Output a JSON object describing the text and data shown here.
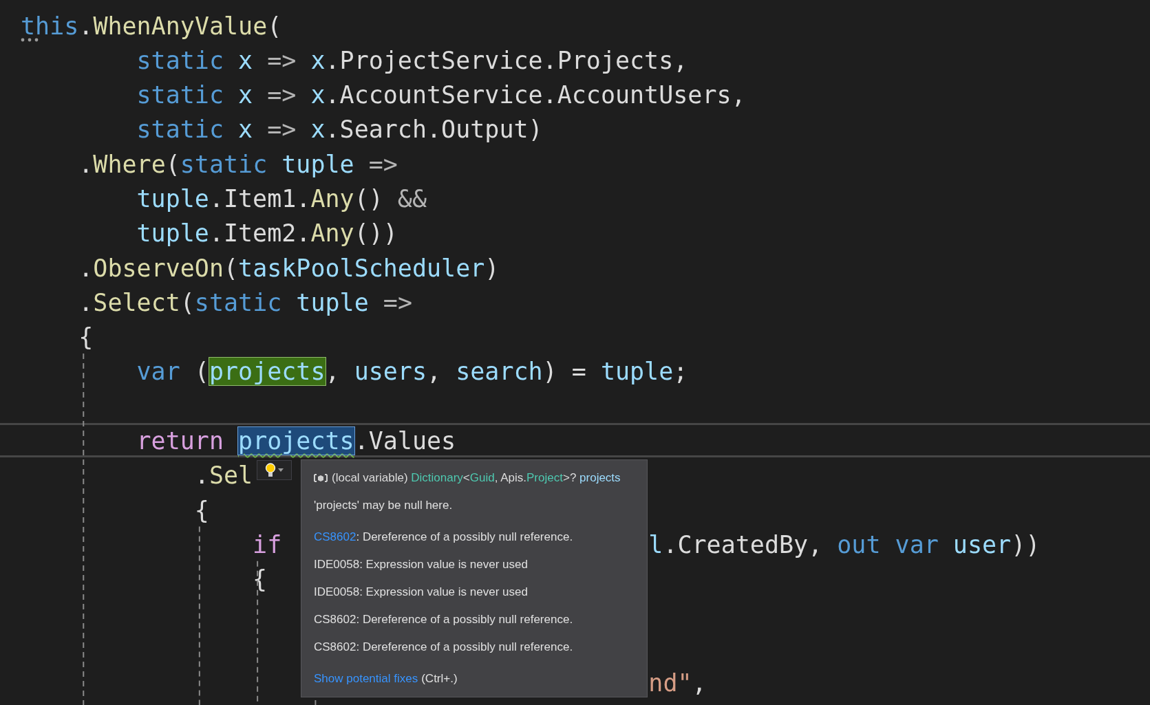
{
  "editor": {
    "lines": [
      {
        "segments": [
          {
            "tokens": [
              {
                "text": "this",
                "kind": "keyword"
              },
              {
                "text": ".",
                "kind": "plain"
              },
              {
                "text": "WhenAnyValue",
                "kind": "method"
              },
              {
                "text": "(",
                "kind": "plain"
              }
            ]
          }
        ],
        "suggestion_dots": true,
        "children": [
          {
            "kind": "argument",
            "segments": [
              {
                "tokens": [
                  {
                    "text": "static",
                    "kind": "keyword"
                  },
                  {
                    "text": " x",
                    "kind": "variable"
                  },
                  {
                    "text": " => ",
                    "kind": "operator"
                  },
                  {
                    "text": "x",
                    "kind": "variable"
                  },
                  {
                    "text": ".ProjectService.Projects,",
                    "kind": "plain"
                  }
                ]
              }
            ]
          },
          {
            "kind": "argument",
            "segments": [
              {
                "tokens": [
                  {
                    "text": "static",
                    "kind": "keyword"
                  },
                  {
                    "text": " x",
                    "kind": "variable"
                  },
                  {
                    "text": " => ",
                    "kind": "operator"
                  },
                  {
                    "text": "x",
                    "kind": "variable"
                  },
                  {
                    "text": ".AccountService.AccountUsers,",
                    "kind": "plain"
                  }
                ]
              }
            ]
          },
          {
            "kind": "argument",
            "segments": [
              {
                "tokens": [
                  {
                    "text": "static",
                    "kind": "keyword"
                  },
                  {
                    "text": " x",
                    "kind": "variable"
                  },
                  {
                    "text": " => ",
                    "kind": "operator"
                  },
                  {
                    "text": "x",
                    "kind": "variable"
                  },
                  {
                    "text": ".Search.Output)",
                    "kind": "plain"
                  }
                ]
              }
            ]
          },
          {
            "segments": [
              {
                "tokens": [
                  {
                    "text": ".",
                    "kind": "plain"
                  },
                  {
                    "text": "Where",
                    "kind": "method"
                  },
                  {
                    "text": "(",
                    "kind": "plain"
                  },
                  {
                    "text": "static",
                    "kind": "keyword"
                  },
                  {
                    "text": " tuple",
                    "kind": "variable"
                  },
                  {
                    "text": " =>",
                    "kind": "operator"
                  }
                ]
              }
            ],
            "children": [
              {
                "segments": [
                  {
                    "tokens": [
                      {
                        "text": "tuple",
                        "kind": "variable"
                      },
                      {
                        "text": ".Item1.",
                        "kind": "plain"
                      },
                      {
                        "text": "Any",
                        "kind": "method"
                      },
                      {
                        "text": "() ",
                        "kind": "plain"
                      },
                      {
                        "text": "&&",
                        "kind": "operator"
                      }
                    ]
                  }
                ]
              },
              {
                "segments": [
                  {
                    "tokens": [
                      {
                        "text": "tuple",
                        "kind": "variable"
                      },
                      {
                        "text": ".Item2.",
                        "kind": "plain"
                      },
                      {
                        "text": "Any",
                        "kind": "method"
                      },
                      {
                        "text": "())",
                        "kind": "plain"
                      }
                    ]
                  }
                ]
              }
            ]
          },
          {
            "segments": [
              {
                "tokens": [
                  {
                    "text": ".",
                    "kind": "plain"
                  },
                  {
                    "text": "ObserveOn",
                    "kind": "method"
                  },
                  {
                    "text": "(",
                    "kind": "plain"
                  },
                  {
                    "text": "taskPoolScheduler",
                    "kind": "variable"
                  },
                  {
                    "text": ")",
                    "kind": "plain"
                  }
                ]
              }
            ]
          },
          {
            "segments": [
              {
                "tokens": [
                  {
                    "text": ".",
                    "kind": "plain"
                  },
                  {
                    "text": "Select",
                    "kind": "method"
                  },
                  {
                    "text": "(",
                    "kind": "plain"
                  },
                  {
                    "text": "static",
                    "kind": "keyword"
                  },
                  {
                    "text": " tuple",
                    "kind": "variable"
                  },
                  {
                    "text": " =>",
                    "kind": "operator"
                  }
                ]
              }
            ]
          },
          {
            "segments": [
              {
                "tokens": [
                  {
                    "text": "{",
                    "kind": "plain"
                  }
                ]
              }
            ],
            "children": [
              {
                "segments": [
                  {
                    "tokens": [
                      {
                        "text": "var",
                        "kind": "keyword"
                      },
                      {
                        "text": " (",
                        "kind": "plain"
                      },
                      {
                        "text": "projects",
                        "kind": "variable",
                        "highlighted": true
                      },
                      {
                        "text": ", ",
                        "kind": "plain"
                      },
                      {
                        "text": "users",
                        "kind": "variable"
                      },
                      {
                        "text": ", ",
                        "kind": "plain"
                      },
                      {
                        "text": "search",
                        "kind": "variable"
                      },
                      {
                        "text": ") = ",
                        "kind": "plain"
                      },
                      {
                        "text": "tuple",
                        "kind": "variable"
                      },
                      {
                        "text": ";",
                        "kind": "plain"
                      }
                    ]
                  }
                ]
              },
              {
                "kind": "blank"
              },
              {
                "current": true,
                "segments": [
                  {
                    "tokens": [
                      {
                        "text": "return ",
                        "kind": "control"
                      },
                      {
                        "text": "projects",
                        "kind": "variable",
                        "selected": true,
                        "squiggle": true
                      },
                      {
                        "text": ".Values",
                        "kind": "plain"
                      }
                    ]
                  }
                ],
                "children": [
                  {
                    "segments": [
                      {
                        "tokens": [
                          {
                            "text": ".",
                            "kind": "plain"
                          },
                          {
                            "text": "Sel",
                            "kind": "method"
                          }
                        ]
                      }
                    ]
                  },
                  {
                    "segments": [
                      {
                        "tokens": [
                          {
                            "text": "{",
                            "kind": "plain"
                          }
                        ]
                      }
                    ],
                    "children": [
                      {
                        "segments": [
                          {
                            "tokens": [
                              {
                                "text": "if",
                                "kind": "control"
                              }
                            ]
                          },
                          {
                            "after_tooltip": true,
                            "tokens": [
                              {
                                "text": "l",
                                "kind": "variable"
                              },
                              {
                                "text": ".CreatedBy, ",
                                "kind": "plain"
                              },
                              {
                                "text": "out",
                                "kind": "keyword"
                              },
                              {
                                "text": " var",
                                "kind": "keyword"
                              },
                              {
                                "text": " user",
                                "kind": "variable"
                              },
                              {
                                "text": "))",
                                "kind": "plain"
                              }
                            ]
                          }
                        ]
                      },
                      {
                        "segments": [
                          {
                            "tokens": [
                              {
                                "text": "{",
                                "kind": "plain"
                              }
                            ]
                          }
                        ],
                        "children": [
                          {
                            "kind": "blank"
                          },
                          {
                            "kind": "blank"
                          },
                          {
                            "segments": [
                              {
                                "after_tooltip": true,
                                "tokens": [
                                  {
                                    "text": "nd\"",
                                    "kind": "string"
                                  },
                                  {
                                    "text": ",",
                                    "kind": "plain"
                                  }
                                ]
                              }
                            ]
                          }
                        ]
                      }
                    ]
                  }
                ]
              }
            ]
          }
        ]
      }
    ]
  },
  "quick_info": {
    "header": [
      {
        "text": "(local variable) ",
        "kind": "plain"
      },
      {
        "text": "Dictionary",
        "kind": "type"
      },
      {
        "text": "<",
        "kind": "plain"
      },
      {
        "text": "Guid",
        "kind": "type"
      },
      {
        "text": ", Apis.",
        "kind": "plain"
      },
      {
        "text": "Project",
        "kind": "type"
      },
      {
        "text": ">? ",
        "kind": "plain"
      },
      {
        "text": "projects",
        "kind": "variable"
      }
    ],
    "message": "'projects' may be null here.",
    "diagnostics": [
      {
        "code": "CS8602",
        "linked": true,
        "message": ": Dereference of a possibly null reference."
      },
      {
        "code": "IDE0058",
        "linked": false,
        "message": ": Expression value is never used"
      },
      {
        "code": "IDE0058",
        "linked": false,
        "message": ": Expression value is never used"
      },
      {
        "code": "CS8602",
        "linked": false,
        "message": ": Dereference of a possibly null reference."
      },
      {
        "code": "CS8602",
        "linked": false,
        "message": ": Dereference of a possibly null reference."
      }
    ],
    "fixes_link": "Show potential fixes",
    "shortcut": "(Ctrl+.)"
  }
}
